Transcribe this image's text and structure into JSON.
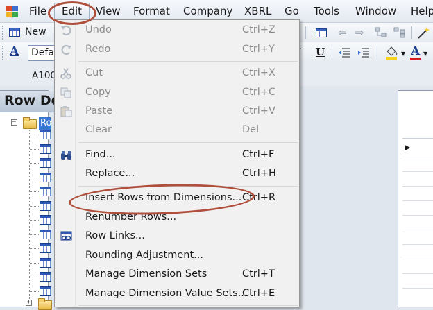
{
  "menubar": {
    "items": [
      "File",
      "Edit",
      "View",
      "Format",
      "Company",
      "XBRL",
      "Go",
      "Tools",
      "Window",
      "Help"
    ],
    "active": "Edit"
  },
  "toolbar": {
    "new_label": "New",
    "font_value": "Defau",
    "cell_ref": "A100"
  },
  "row_panel": {
    "title": "Row De",
    "root_label": "Ro"
  },
  "edit_menu": {
    "items": [
      {
        "label": "Undo",
        "shortcut": "Ctrl+Z",
        "enabled": false,
        "icon": "undo-icon"
      },
      {
        "label": "Redo",
        "shortcut": "Ctrl+Y",
        "enabled": false,
        "icon": "redo-icon"
      },
      {
        "label": "Cut",
        "shortcut": "Ctrl+X",
        "enabled": false,
        "icon": "scissors-icon"
      },
      {
        "label": "Copy",
        "shortcut": "Ctrl+C",
        "enabled": false,
        "icon": "copy-icon"
      },
      {
        "label": "Paste",
        "shortcut": "Ctrl+V",
        "enabled": false,
        "icon": "paste-icon"
      },
      {
        "label": "Clear",
        "shortcut": "Del",
        "enabled": false,
        "icon": ""
      },
      {
        "label": "Find...",
        "shortcut": "Ctrl+F",
        "enabled": true,
        "icon": "binoculars-icon"
      },
      {
        "label": "Replace...",
        "shortcut": "Ctrl+H",
        "enabled": true,
        "icon": ""
      },
      {
        "label": "Insert Rows from Dimensions...",
        "shortcut": "Ctrl+R",
        "enabled": true,
        "icon": ""
      },
      {
        "label": "Renumber Rows...",
        "shortcut": "",
        "enabled": true,
        "icon": ""
      },
      {
        "label": "Row Links...",
        "shortcut": "",
        "enabled": true,
        "icon": "link-icon"
      },
      {
        "label": "Rounding Adjustment...",
        "shortcut": "",
        "enabled": true,
        "icon": ""
      },
      {
        "label": "Manage Dimension Sets",
        "shortcut": "Ctrl+T",
        "enabled": true,
        "icon": ""
      },
      {
        "label": "Manage Dimension Value Sets...",
        "shortcut": "Ctrl+E",
        "enabled": true,
        "icon": ""
      }
    ]
  },
  "colors": {
    "annotation": "#b0503c",
    "font_color_red": "#d21c1c",
    "highlight_yellow": "#f4d21f"
  }
}
